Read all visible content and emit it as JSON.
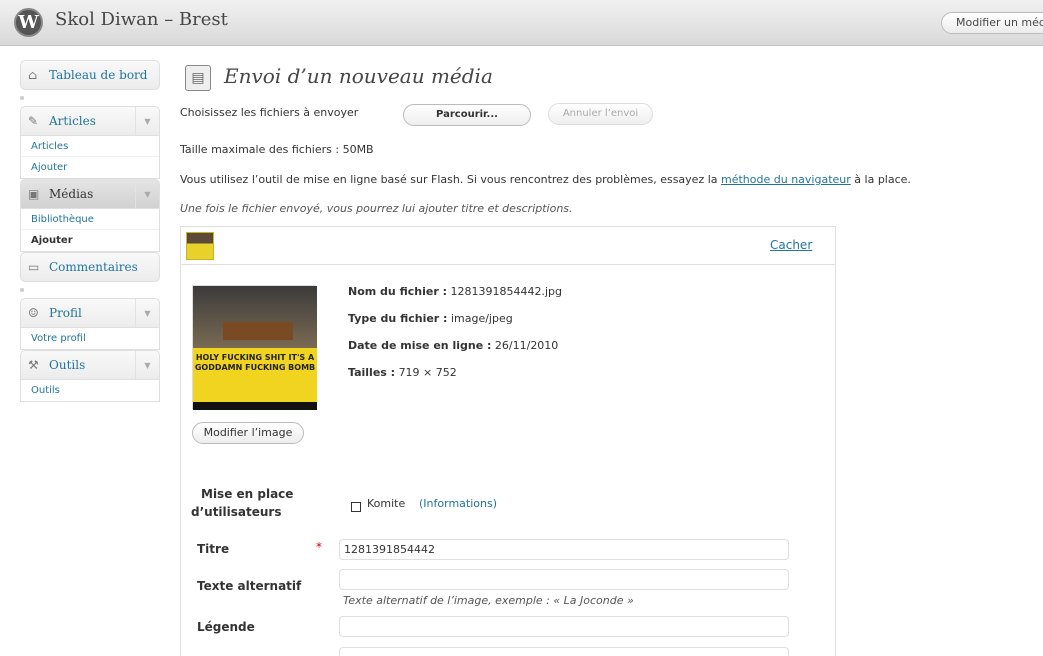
{
  "header": {
    "logo_letter": "W",
    "site_title": "Skol Diwan – Brest",
    "action_button": "Modifier un média"
  },
  "menu": {
    "dashboard": "Tableau de bord",
    "articles": "Articles",
    "articles_sub": [
      "Articles",
      "Ajouter"
    ],
    "media": "Médias",
    "media_sub": [
      "Bibliothèque",
      "Ajouter"
    ],
    "comments": "Commentaires",
    "profile": "Profil",
    "profile_sub": [
      "Votre profil"
    ],
    "tools": "Outils",
    "tools_sub": [
      "Outils"
    ]
  },
  "page": {
    "title": "Envoi d’un nouveau média",
    "choose_label": "Choisissez les fichiers à envoyer",
    "browse_button": "Parcourir...",
    "cancel_button": "Annuler l’envoi",
    "max_size": "Taille maximale des fichiers : 50MB",
    "flash_note_before": "Vous utilisez l’outil de mise en ligne basé sur Flash. Si vous rencontrez des problèmes, essayez la ",
    "flash_note_link": "méthode du navigateur",
    "flash_note_after": " à la place.",
    "after_upload_note": "Une fois le fichier envoyé, vous pourrez lui ajouter titre et descriptions."
  },
  "media_item": {
    "hide_link": "Cacher",
    "thumb_caption": "HOLY FUCKING SHIT IT'S A GODDAMN FUCKING BOMB",
    "edit_image_button": "Modifier l’image",
    "filename_label": "Nom du fichier :",
    "filename": "1281391854442.jpg",
    "filetype_label": "Type du fichier :",
    "filetype": "image/jpeg",
    "date_label": "Date de mise en ligne :",
    "date": "26/11/2010",
    "size_label": "Tailles :",
    "size": "719 × 752",
    "user_label_line1": "Mise en place",
    "user_label_line2": "d’utilisateurs",
    "checkbox_label": "Komite",
    "info_link": "(Informations)",
    "title_label": "Titre",
    "required_mark": "*",
    "title_value": "1281391854442",
    "alt_label": "Texte alternatif",
    "alt_value": "",
    "alt_help": "Texte alternatif de l’image, exemple : « La Joconde »",
    "caption_label": "Légende",
    "caption_value": ""
  }
}
